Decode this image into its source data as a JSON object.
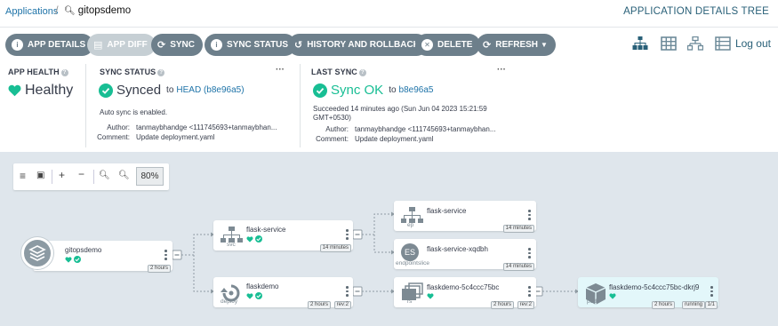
{
  "breadcrumb": {
    "root": "Applications",
    "app": "gitopsdemo"
  },
  "header": {
    "title": "APPLICATION DETAILS TREE"
  },
  "toolbar": {
    "app_details": "APP DETAILS",
    "app_diff": "APP DIFF",
    "sync": "SYNC",
    "sync_status": "SYNC STATUS",
    "history": "HISTORY AND ROLLBACK",
    "delete": "DELETE",
    "refresh": "REFRESH"
  },
  "logout": "Log out",
  "app_health": {
    "heading": "APP HEALTH",
    "value": "Healthy"
  },
  "sync_status": {
    "heading": "SYNC STATUS",
    "value": "Synced",
    "to": "to",
    "target": "HEAD (b8e96a5)",
    "auto_sync": "Auto sync is enabled.",
    "author_label": "Author:",
    "author": "tanmaybhandge <111745693+tanmaybhan...",
    "comment_label": "Comment:",
    "comment": "Update deployment.yaml"
  },
  "last_sync": {
    "heading": "LAST SYNC",
    "value": "Sync OK",
    "to": "to",
    "target": "b8e96a5",
    "succeeded": "Succeeded 14 minutes ago (Sun Jun 04 2023 15:21:59",
    "tz": "GMT+0530)",
    "author_label": "Author:",
    "author": "tanmaybhandge <111745693+tanmaybhan...",
    "comment_label": "Comment:",
    "comment": "Update deployment.yaml"
  },
  "zoom": {
    "level": "80%"
  },
  "colors": {
    "healthy": "#18be94",
    "button": "#6d7f8b",
    "link": "#1e73a8"
  },
  "graph": {
    "app": {
      "name": "gitopsdemo",
      "age": "2 hours"
    },
    "svc": {
      "name": "flask-service",
      "kind": "svc",
      "age": "14 minutes"
    },
    "deploy": {
      "name": "flaskdemo",
      "kind": "deploy",
      "age": "2 hours",
      "rev": "rev:2"
    },
    "ep": {
      "name": "flask-service",
      "kind": "ep",
      "age": "14 minutes"
    },
    "eps": {
      "name": "flask-service-xqdbh",
      "kind": "endpointslice",
      "badge": "ES",
      "age": "14 minutes"
    },
    "rs": {
      "name": "flaskdemo-5c4ccc75bc",
      "kind": "rs",
      "age": "2 hours",
      "rev": "rev:2"
    },
    "pod": {
      "name": "flaskdemo-5c4ccc75bc-dkrj9",
      "kind": "pod",
      "age": "2 hours",
      "status": "running",
      "ready": "1/1"
    }
  }
}
